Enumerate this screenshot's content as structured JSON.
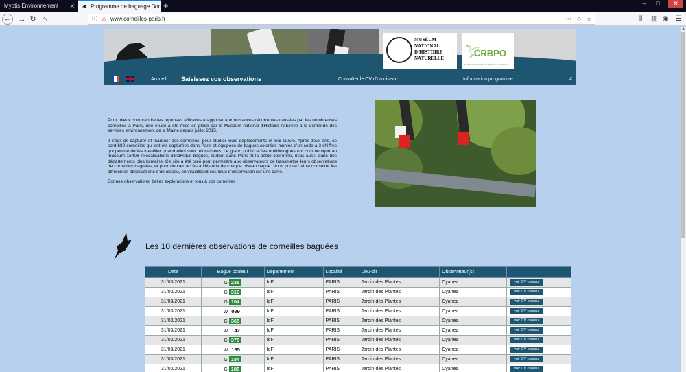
{
  "browser": {
    "tabs": [
      {
        "title": "Myotis Environnement"
      },
      {
        "title": "Programme de baguage Corn"
      }
    ],
    "url": "www.corneilles-paris.fr"
  },
  "menu": {
    "accueil": "Accueil",
    "saisissez": "Saisissez vos observations",
    "consulter": "Consulter le CV d'un oiseau",
    "information": "Information programme",
    "hash": "#"
  },
  "logos": {
    "mnhn": "MUSÉUM NATIONAL D'HISTOIRE NATURELLE",
    "crbpo": "CRBPO",
    "crbpo_sub": "MUSÉUM NATIONAL D'HISTOIRE NATURELLE"
  },
  "intro": {
    "p1": "Pour mieux comprendre les réponses efficaces à apporter aux nuisances récurrentes causées par les nombreuses corneilles à Paris, une étude a été mise en place par le Muséum national d'Histoire naturelle à la demande des services environnement de la Mairie depuis juillet 2015.",
    "p2": "Il s'agit de capturer et marquer des corneilles, pour étudier leurs déplacements et leur survie. Après deux ans, ce sont 682 corneilles qui ont été capturées dans Paris et équipées de bagues colorées munies d'un code à 3 chiffres qui permet de les identifier quand elles sont relocalisées. Le grand public et les ornithologues ont communiqué au muséum 15408 relocalisations d'individus bagués, surtout dans Paris et la petite couronne, mais aussi dans des départements plus lointains. Ce site a été créé pour permettre aux observateurs de transmettre leurs observations de corneilles baguées, et pour donner accès à l'historie de chaque oiseau bagué. Vous pouvez ainsi consulter les différentes observations d'un oiseau, en visualisant ses lieux d'observation sur une carte.",
    "p3": "Bonnes observations, belles explorations et tous à vos corneilles !"
  },
  "section_title": "Les 10 dernières observations de corneilles baguées",
  "table": {
    "headers": [
      "Date",
      "Bague couleur",
      "Département",
      "Localité",
      "Lieu-dit",
      "Observateur(s)",
      ""
    ],
    "button_label": "voir CV oiseau",
    "rows": [
      {
        "date": "31/03/2021",
        "color": "G",
        "code": "235",
        "style": "green",
        "dept": "IdF",
        "loc": "PARIS",
        "lieu": "Jardin des Plantes",
        "obs": "Cyanea"
      },
      {
        "date": "31/03/2021",
        "color": "G",
        "code": "316",
        "style": "green",
        "dept": "IdF",
        "loc": "PARIS",
        "lieu": "Jardin des Plantes",
        "obs": "Cyanea"
      },
      {
        "date": "31/03/2021",
        "color": "G",
        "code": "104",
        "style": "green",
        "dept": "IdF",
        "loc": "PARIS",
        "lieu": "Jardin des Plantes",
        "obs": "Cyanea"
      },
      {
        "date": "31/03/2021",
        "color": "W",
        "code": "099",
        "style": "white",
        "dept": "IdF",
        "loc": "PARIS",
        "lieu": "Jardin des Plantes",
        "obs": "Cyanea"
      },
      {
        "date": "31/03/2021",
        "color": "G",
        "code": "365",
        "style": "green",
        "dept": "IdF",
        "loc": "PARIS",
        "lieu": "Jardin des Plantes",
        "obs": "Cyanea"
      },
      {
        "date": "31/03/2021",
        "color": "W",
        "code": "142",
        "style": "white",
        "dept": "IdF",
        "loc": "PARIS",
        "lieu": "Jardin des Plantes",
        "obs": "Cyanea"
      },
      {
        "date": "31/03/2021",
        "color": "G",
        "code": "375",
        "style": "green",
        "dept": "IdF",
        "loc": "PARIS",
        "lieu": "Jardin des Plantes",
        "obs": "Cyanea"
      },
      {
        "date": "31/03/2021",
        "color": "W",
        "code": "165",
        "style": "white",
        "dept": "IdF",
        "loc": "PARIS",
        "lieu": "Jardin des Plantes",
        "obs": "Cyanea"
      },
      {
        "date": "31/03/2021",
        "color": "G",
        "code": "184",
        "style": "green",
        "dept": "IdF",
        "loc": "PARIS",
        "lieu": "Jardin des Plantes",
        "obs": "Cyanea"
      },
      {
        "date": "31/03/2021",
        "color": "G",
        "code": "180",
        "style": "green",
        "dept": "IdF",
        "loc": "PARIS",
        "lieu": "Jardin des Plantes",
        "obs": "Cyanea"
      }
    ]
  },
  "colors": {
    "accent": "#1e5672",
    "page_bg": "#b7d0ee",
    "ring_green": "#2e8b3e"
  }
}
